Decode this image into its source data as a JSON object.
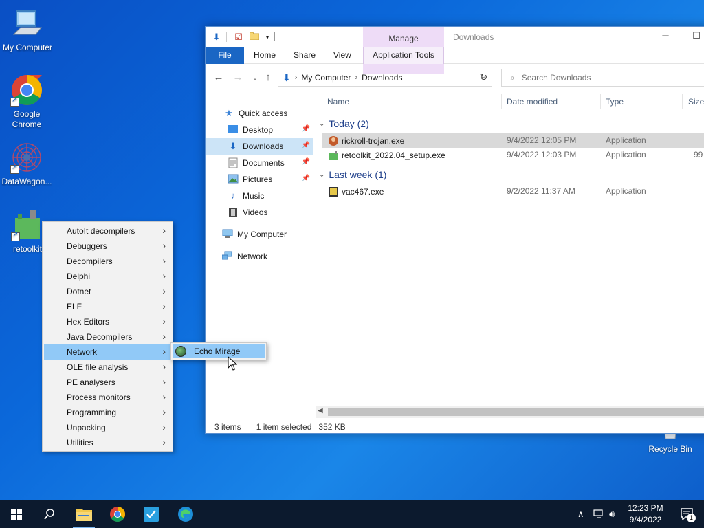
{
  "desktop": {
    "icons": [
      {
        "label": "My Computer"
      },
      {
        "label": "Google Chrome"
      },
      {
        "label": "DataWagon..."
      },
      {
        "label": "retoolkit"
      },
      {
        "label": "Recycle Bin"
      }
    ]
  },
  "explorer": {
    "context_tab": "Manage",
    "title": "Downloads",
    "ribbon_tabs": [
      "File",
      "Home",
      "Share",
      "View",
      "Application Tools"
    ],
    "breadcrumb": [
      "My Computer",
      "Downloads"
    ],
    "search_placeholder": "Search Downloads",
    "nav": {
      "quick_access": "Quick access",
      "items": [
        "Desktop",
        "Downloads",
        "Documents",
        "Pictures",
        "Music",
        "Videos"
      ],
      "my_computer": "My Computer",
      "network": "Network"
    },
    "columns": [
      "Name",
      "Date modified",
      "Type",
      "Size"
    ],
    "groups": [
      {
        "label": "Today (2)",
        "files": [
          {
            "name": "rickroll-trojan.exe",
            "date": "9/4/2022 12:05 PM",
            "type": "Application",
            "size": ""
          },
          {
            "name": "retoolkit_2022.04_setup.exe",
            "date": "9/4/2022 12:03 PM",
            "type": "Application",
            "size": "99"
          }
        ]
      },
      {
        "label": "Last week (1)",
        "files": [
          {
            "name": "vac467.exe",
            "date": "9/2/2022 11:37 AM",
            "type": "Application",
            "size": ""
          }
        ]
      }
    ],
    "status": {
      "count": "3 items",
      "selected": "1 item selected",
      "size": "352 KB"
    }
  },
  "context_menu": {
    "items": [
      "AutoIt decompilers",
      "Debuggers",
      "Decompilers",
      "Delphi",
      "Dotnet",
      "ELF",
      "Hex Editors",
      "Java Decompilers",
      "Network",
      "OLE file analysis",
      "PE analysers",
      "Process monitors",
      "Programming",
      "Unpacking",
      "Utilities"
    ],
    "highlighted": "Network",
    "submenu_item": "Echo Mirage"
  },
  "taskbar": {
    "clock_time": "12:23 PM",
    "clock_date": "9/4/2022",
    "notification_count": "1"
  },
  "colors": {
    "accent": "#1a66c4",
    "menu_highlight": "#91c9f7",
    "manage_tab": "#eedcf7",
    "taskbar": "#0c1a2e"
  }
}
